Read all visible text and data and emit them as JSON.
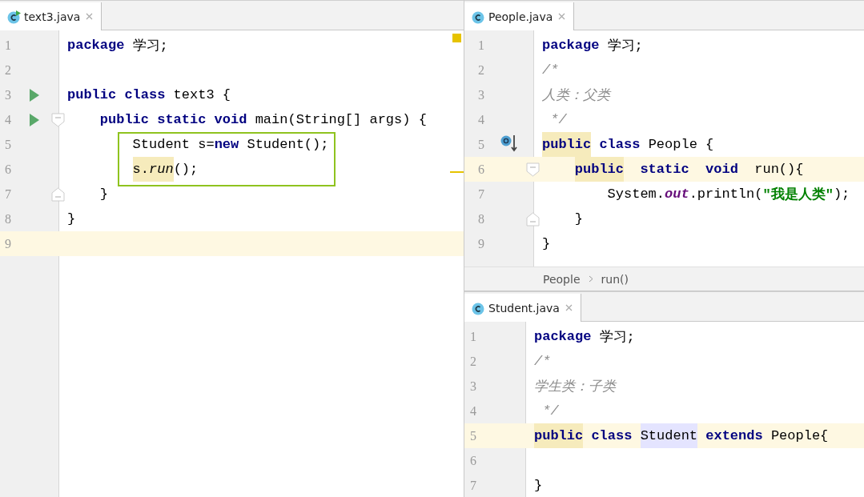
{
  "panes": [
    {
      "tab": {
        "label": "text3.java",
        "selected": true,
        "runnable": true
      },
      "lines": [
        {
          "number": "1",
          "tokens": [
            {
              "text": "package",
              "kind": "keyword"
            },
            {
              "text": " 学习;",
              "kind": "text"
            }
          ]
        },
        {
          "number": "2"
        },
        {
          "number": "3",
          "markers": [
            {
              "kind": "run"
            }
          ],
          "tokens": [
            {
              "text": "public class",
              "kind": "keyword"
            },
            {
              "text": " text3 {",
              "kind": "text"
            }
          ],
          "children": [
            {
              "number": "4",
              "markers": [
                {
                  "kind": "run"
                },
                {
                  "kind": "fold-open"
                }
              ],
              "tokens": [
                {
                  "text": "public static void",
                  "kind": "keyword"
                },
                {
                  "text": " main(String[] args) {",
                  "kind": "text"
                }
              ],
              "children": [
                {
                  "number": "5",
                  "boxed": true,
                  "tokens": [
                    {
                      "text": "Student s=",
                      "kind": "text"
                    },
                    {
                      "text": "new",
                      "kind": "keyword"
                    },
                    {
                      "text": " Student();",
                      "kind": "text"
                    }
                  ]
                },
                {
                  "number": "6",
                  "boxed": true,
                  "tokens": [
                    {
                      "text": "s.",
                      "kind": "text",
                      "highlighted": true
                    },
                    {
                      "text": "run",
                      "kind": "method",
                      "highlighted": true
                    },
                    {
                      "text": "();",
                      "kind": "text"
                    }
                  ]
                }
              ]
            },
            {
              "number": "7",
              "markers": [
                {
                  "kind": "fold-close"
                }
              ],
              "tokens": [
                {
                  "text": "}",
                  "kind": "text"
                }
              ]
            }
          ]
        },
        {
          "number": "8",
          "tokens": [
            {
              "text": "}",
              "kind": "text"
            }
          ]
        },
        {
          "number": "9",
          "current": true
        }
      ]
    },
    {
      "tab": {
        "label": "People.java",
        "selected": true
      },
      "lines": [
        {
          "number": "1",
          "tokens": [
            {
              "text": "package",
              "kind": "keyword"
            },
            {
              "text": " 学习;",
              "kind": "text"
            }
          ]
        },
        {
          "number": "2",
          "tokens": [
            {
              "text": "/*",
              "kind": "comment"
            }
          ]
        },
        {
          "number": "3",
          "tokens": [
            {
              "text": "人类：父类",
              "kind": "comment"
            }
          ]
        },
        {
          "number": "4",
          "tokens": [
            {
              "text": " */",
              "kind": "comment"
            }
          ]
        },
        {
          "number": "5",
          "markers": [
            {
              "kind": "overridden"
            }
          ],
          "tokens": [
            {
              "text": "public",
              "kind": "keyword",
              "highlighted": true
            },
            {
              "text": " class",
              "kind": "keyword"
            },
            {
              "text": " People {",
              "kind": "text"
            }
          ],
          "children": [
            {
              "number": "6",
              "current": true,
              "markers": [
                {
                  "kind": "fold-open"
                }
              ],
              "tokens": [
                {
                  "text": "public",
                  "kind": "keyword",
                  "highlighted": true
                },
                {
                  "text": "  static  void",
                  "kind": "keyword"
                },
                {
                  "text": "  run(){",
                  "kind": "text"
                }
              ],
              "children": [
                {
                  "number": "7",
                  "tokens": [
                    {
                      "text": "System.",
                      "kind": "text"
                    },
                    {
                      "text": "out",
                      "kind": "static-field"
                    },
                    {
                      "text": ".println(",
                      "kind": "text"
                    },
                    {
                      "text": "\"我是人类\"",
                      "kind": "string"
                    },
                    {
                      "text": ");",
                      "kind": "text"
                    }
                  ]
                }
              ]
            },
            {
              "number": "8",
              "markers": [
                {
                  "kind": "fold-close"
                }
              ],
              "tokens": [
                {
                  "text": "}",
                  "kind": "text"
                }
              ]
            }
          ]
        },
        {
          "number": "9",
          "tokens": [
            {
              "text": "}",
              "kind": "text"
            }
          ]
        }
      ],
      "breadcrumb": [
        "People",
        "run()"
      ]
    },
    {
      "tab": {
        "label": "Student.java",
        "selected": true
      },
      "lines": [
        {
          "number": "1",
          "tokens": [
            {
              "text": "package",
              "kind": "keyword"
            },
            {
              "text": " 学习;",
              "kind": "text"
            }
          ]
        },
        {
          "number": "2",
          "tokens": [
            {
              "text": "/*",
              "kind": "comment"
            }
          ]
        },
        {
          "number": "3",
          "tokens": [
            {
              "text": "学生类：子类",
              "kind": "comment"
            }
          ]
        },
        {
          "number": "4",
          "tokens": [
            {
              "text": " */",
              "kind": "comment"
            }
          ]
        },
        {
          "number": "5",
          "current": true,
          "tokens": [
            {
              "text": "public",
              "kind": "keyword",
              "highlighted": true
            },
            {
              "text": " class ",
              "kind": "keyword"
            },
            {
              "text": "Student",
              "kind": "text",
              "reference": true
            },
            {
              "text": " extends",
              "kind": "keyword"
            },
            {
              "text": " People{",
              "kind": "text"
            }
          ]
        },
        {
          "number": "6"
        },
        {
          "number": "7",
          "tokens": [
            {
              "text": "}",
              "kind": "text"
            }
          ]
        }
      ]
    }
  ]
}
